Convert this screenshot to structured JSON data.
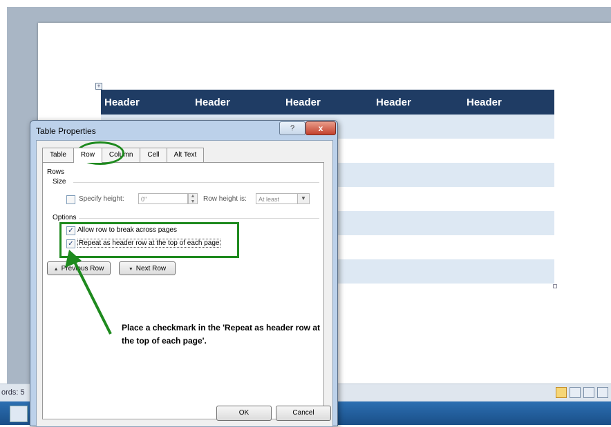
{
  "document": {
    "table": {
      "headers": [
        "Header",
        "Header",
        "Header",
        "Header",
        "Header"
      ],
      "body_rows": 7
    }
  },
  "status_bar": {
    "words_text": "ords: 5"
  },
  "dialog": {
    "title": "Table Properties",
    "help_label": "?",
    "close_label": "x",
    "tabs": [
      {
        "label": "Table",
        "active": false
      },
      {
        "label": "Row",
        "active": true
      },
      {
        "label": "Column",
        "active": false
      },
      {
        "label": "Cell",
        "active": false
      },
      {
        "label": "Alt Text",
        "active": false
      }
    ],
    "rows_section": "Rows",
    "size_section": "Size",
    "specify_height": {
      "label": "Specify height:",
      "checked": false,
      "value": "0\""
    },
    "row_height_is": {
      "label": "Row height is:",
      "value": "At least"
    },
    "options_section": "Options",
    "allow_break": {
      "label": "Allow row to break across pages",
      "checked": true
    },
    "repeat_header": {
      "label": "Repeat as header row at the top of each page",
      "checked": true
    },
    "previous_row_label": "Previous Row",
    "next_row_label": "Next Row",
    "ok_label": "OK",
    "cancel_label": "Cancel"
  },
  "annotation": {
    "note": "Place a checkmark in the 'Repeat as header row at the top of each page'.",
    "color": "#1e8a1e"
  },
  "colors": {
    "table_header": "#1f3c64",
    "table_band": "#dde8f3"
  }
}
